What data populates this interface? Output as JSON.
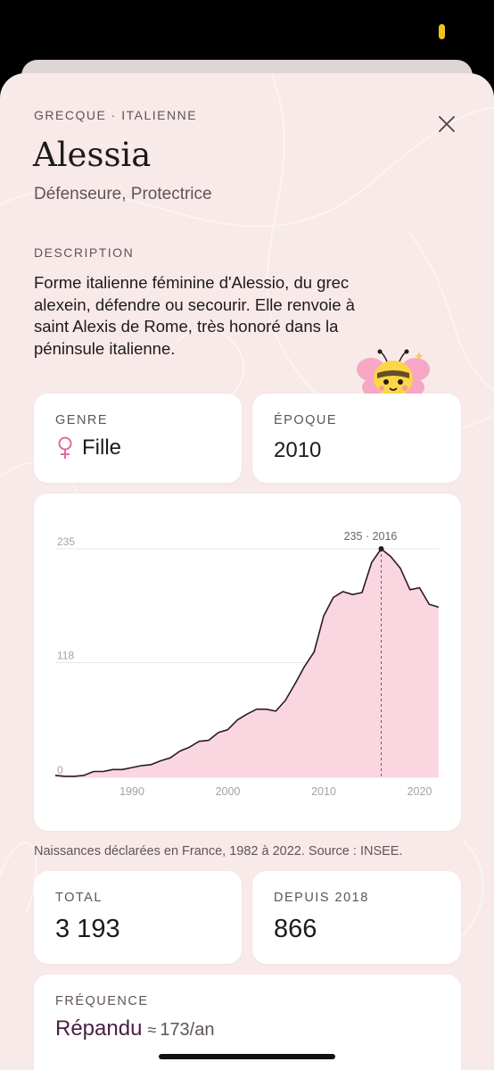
{
  "status_bar": {
    "indicator_color": "#f2c21a"
  },
  "sheet": {
    "origin": "GRECQUE · ITALIENNE",
    "name": "Alessia",
    "meaning": "Défenseure, Protectrice",
    "description_label": "DESCRIPTION",
    "description": "Forme italienne féminine d'Alessio, du grec alexein, défendre ou secourir. Elle renvoie à saint Alexis de Rome, très honoré dans la péninsule italienne.",
    "mascot_icon": "bee-icon"
  },
  "cards": {
    "genre_label": "GENRE",
    "genre_value": "Fille",
    "genre_icon": "female-symbol-icon",
    "epoque_label": "ÉPOQUE",
    "epoque_value": "2010",
    "total_label": "TOTAL",
    "total_value": "3 193",
    "since_label": "DEPUIS 2018",
    "since_value": "866",
    "freq_label": "FRÉQUENCE",
    "freq_word": "Répandu",
    "freq_approx": "≈",
    "freq_rate": "173/an"
  },
  "chart_data": {
    "type": "area",
    "x": [
      1982,
      1983,
      1984,
      1985,
      1986,
      1987,
      1988,
      1989,
      1990,
      1991,
      1992,
      1993,
      1994,
      1995,
      1996,
      1997,
      1998,
      1999,
      2000,
      2001,
      2002,
      2003,
      2004,
      2005,
      2006,
      2007,
      2008,
      2009,
      2010,
      2011,
      2012,
      2013,
      2014,
      2015,
      2016,
      2017,
      2018,
      2019,
      2020,
      2021,
      2022
    ],
    "values": [
      2,
      1,
      1,
      2,
      6,
      6,
      8,
      8,
      10,
      12,
      13,
      17,
      20,
      27,
      31,
      37,
      38,
      46,
      49,
      59,
      65,
      70,
      70,
      68,
      79,
      96,
      114,
      129,
      166,
      185,
      191,
      188,
      190,
      221,
      235,
      227,
      215,
      193,
      195,
      178,
      175
    ],
    "y_ticks": [
      "0",
      "118",
      "235"
    ],
    "y_tick_values": [
      0,
      118,
      235
    ],
    "x_ticks": [
      "1990",
      "2000",
      "2010",
      "2020"
    ],
    "x_tick_values": [
      1990,
      2000,
      2010,
      2020
    ],
    "ylim": [
      0,
      235
    ],
    "xlim": [
      1982,
      2022
    ],
    "annotation": "235 · 2016",
    "peak_year": 2016,
    "peak_value": 235,
    "fill_color": "#fad6e0",
    "line_color": "#2a1a24",
    "grid": true
  },
  "caption": "Naissances déclarées en France, 1982 à 2022. Source : INSEE."
}
